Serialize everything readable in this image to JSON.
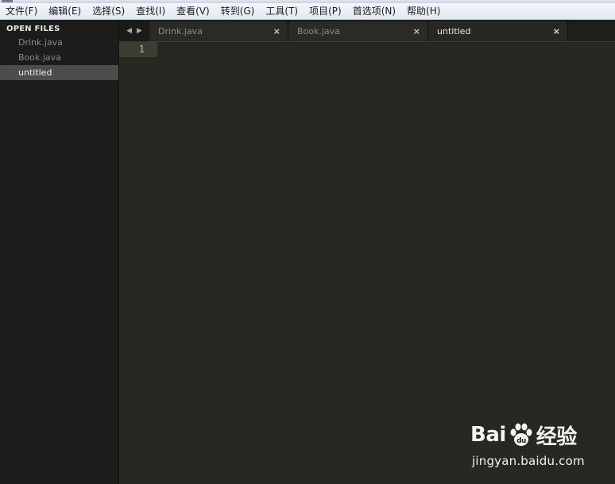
{
  "menu": [
    "文件(F)",
    "编辑(E)",
    "选择(S)",
    "查找(I)",
    "查看(V)",
    "转到(G)",
    "工具(T)",
    "项目(P)",
    "首选项(N)",
    "帮助(H)"
  ],
  "sidebar": {
    "heading": "OPEN FILES",
    "items": [
      {
        "label": "Drink.java",
        "active": false
      },
      {
        "label": "Book.java",
        "active": false
      },
      {
        "label": "untitled",
        "active": true
      }
    ]
  },
  "tabs": {
    "nav_prev": "◀",
    "nav_next": "▶",
    "items": [
      {
        "label": "Drink.java",
        "close": "×",
        "active": false
      },
      {
        "label": "Book.java",
        "close": "×",
        "active": false
      },
      {
        "label": "untitled",
        "close": "×",
        "active": true
      }
    ]
  },
  "editor": {
    "line_numbers": [
      "1"
    ]
  },
  "watermark": {
    "logo_left": "Bai",
    "logo_right": "经验",
    "url": "jingyan.baidu.com"
  },
  "colors": {
    "editor_bg": "#272822",
    "sidebar_bg": "#1c1d1a",
    "active_sidebar_item": "#4c4c4a",
    "current_line": "#3e3d32"
  }
}
